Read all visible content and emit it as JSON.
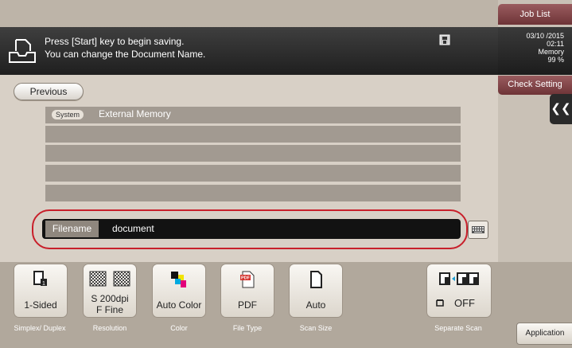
{
  "header": {
    "job_list": "Job List",
    "check_setting": "Check Setting",
    "message_line1": "Press [Start] key to begin saving.",
    "message_line2": "You can change the Document Name.",
    "status": {
      "date": "03/10 /2015",
      "time": "02:11",
      "memory_label": "Memory",
      "memory_value": "99 %"
    }
  },
  "nav": {
    "previous": "Previous"
  },
  "path": {
    "tag": "System",
    "location": "External Memory"
  },
  "filename": {
    "label": "Filename",
    "value": "document"
  },
  "functions": [
    {
      "value": "1-Sided",
      "label": "Simplex/ Duplex",
      "icon": "simplex-page-icon"
    },
    {
      "value_line1": "S 200dpi",
      "value_line2": "F Fine",
      "label": "Resolution",
      "icon": "resolution-checker-icon"
    },
    {
      "value": "Auto Color",
      "label": "Color",
      "icon": "color-squares-icon"
    },
    {
      "value": "PDF",
      "label": "File Type",
      "icon": "pdf-icon"
    },
    {
      "value": "Auto",
      "label": "Scan Size",
      "icon": "page-outline-icon"
    }
  ],
  "separate_scan": {
    "value": "OFF",
    "label": "Separate Scan",
    "icon": "separate-pages-icon"
  },
  "application": "Application",
  "colors": {
    "highlight": "#c81f2a",
    "tab_accent": "#7d4144"
  }
}
